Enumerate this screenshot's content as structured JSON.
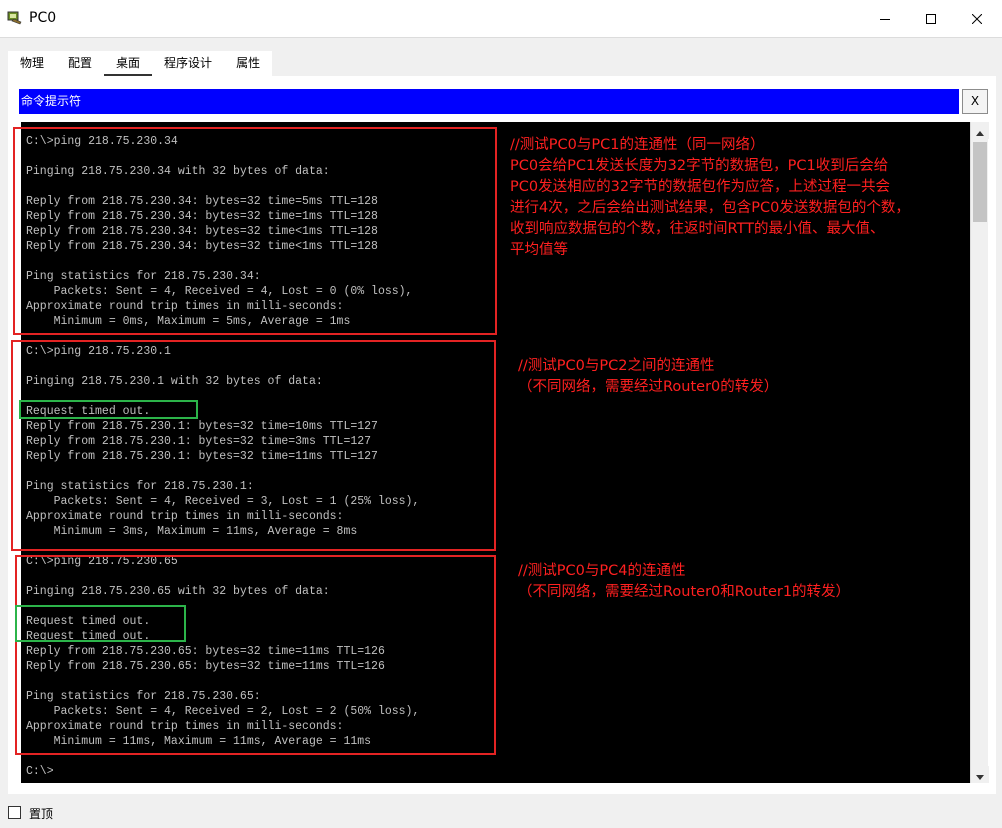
{
  "window": {
    "title": "PC0",
    "app_icon": "computer-icon",
    "controls": {
      "minimize": "minimize-icon",
      "maximize": "maximize-icon",
      "close": "close-icon"
    }
  },
  "tabs": [
    {
      "label": "物理",
      "active": false
    },
    {
      "label": "配置",
      "active": false
    },
    {
      "label": "桌面",
      "active": true
    },
    {
      "label": "程序设计",
      "active": false
    },
    {
      "label": "属性",
      "active": false
    }
  ],
  "command_prompt": {
    "header": "命令提示符",
    "close_label": "X",
    "output": "C:\\>ping 218.75.230.34\n\nPinging 218.75.230.34 with 32 bytes of data:\n\nReply from 218.75.230.34: bytes=32 time=5ms TTL=128\nReply from 218.75.230.34: bytes=32 time=1ms TTL=128\nReply from 218.75.230.34: bytes=32 time<1ms TTL=128\nReply from 218.75.230.34: bytes=32 time<1ms TTL=128\n\nPing statistics for 218.75.230.34:\n    Packets: Sent = 4, Received = 4, Lost = 0 (0% loss),\nApproximate round trip times in milli-seconds:\n    Minimum = 0ms, Maximum = 5ms, Average = 1ms\n\nC:\\>ping 218.75.230.1\n\nPinging 218.75.230.1 with 32 bytes of data:\n\nRequest timed out.\nReply from 218.75.230.1: bytes=32 time=10ms TTL=127\nReply from 218.75.230.1: bytes=32 time=3ms TTL=127\nReply from 218.75.230.1: bytes=32 time=11ms TTL=127\n\nPing statistics for 218.75.230.1:\n    Packets: Sent = 4, Received = 3, Lost = 1 (25% loss),\nApproximate round trip times in milli-seconds:\n    Minimum = 3ms, Maximum = 11ms, Average = 8ms\n\nC:\\>ping 218.75.230.65\n\nPinging 218.75.230.65 with 32 bytes of data:\n\nRequest timed out.\nRequest timed out.\nReply from 218.75.230.65: bytes=32 time=11ms TTL=126\nReply from 218.75.230.65: bytes=32 time=11ms TTL=126\n\nPing statistics for 218.75.230.65:\n    Packets: Sent = 4, Received = 2, Lost = 2 (50% loss),\nApproximate round trip times in milli-seconds:\n    Minimum = 11ms, Maximum = 11ms, Average = 11ms\n\nC:\\>"
  },
  "annotations": [
    {
      "lines": [
        "//测试PC0与PC1的连通性（同一网络）",
        "PC0会给PC1发送长度为32字节的数据包，PC1收到后会给",
        "PC0发送相应的32字节的数据包作为应答，上述过程一共会",
        "进行4次，之后会给出测试结果，包含PC0发送数据包的个数，",
        "收到响应数据包的个数，往返时间RTT的最小值、最大值、",
        "平均值等"
      ]
    },
    {
      "lines": [
        "//测试PC0与PC2之间的连通性",
        "（不同网络，需要经过Router0的转发）"
      ]
    },
    {
      "lines": [
        "//测试PC0与PC4的连通性",
        "（不同网络，需要经过Router0和Router1的转发）"
      ]
    }
  ],
  "colors": {
    "annotation": "#ff2020",
    "highlight_box": "#e32323",
    "timeout_box": "#2cb44a",
    "header": "#0000ff",
    "terminal_bg": "#000000",
    "terminal_text": "#c0c0c0"
  },
  "footer": {
    "checkbox_label": "置顶",
    "checked": false
  }
}
